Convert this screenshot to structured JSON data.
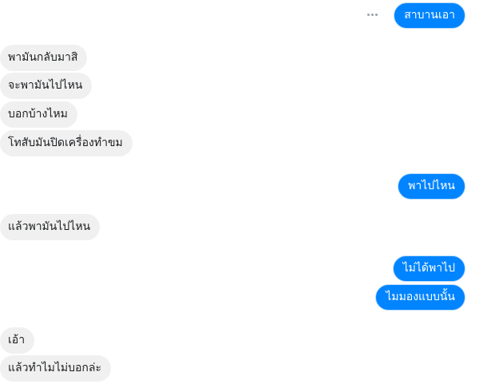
{
  "messages": {
    "m1": {
      "text": "สาบานเอา",
      "direction": "outgoing"
    },
    "m2": {
      "text": "พามันกลับมาสิ",
      "direction": "incoming"
    },
    "m3": {
      "text": "จะพามันไปไหน",
      "direction": "incoming"
    },
    "m4": {
      "text": "บอกบ้างไหม",
      "direction": "incoming"
    },
    "m5": {
      "text": "โทสับมันปิดเครื่องทำขม",
      "direction": "incoming"
    },
    "m6": {
      "text": "พาไปไหน",
      "direction": "outgoing"
    },
    "m7": {
      "text": "แล้วพามันไปไหน",
      "direction": "incoming"
    },
    "m8": {
      "text": "ไม่ได้พาไป",
      "direction": "outgoing"
    },
    "m9": {
      "text": "ไมมองแบบนั้น",
      "direction": "outgoing"
    },
    "m10": {
      "text": "เอ้า",
      "direction": "incoming"
    },
    "m11": {
      "text": "แล้วทำไมไม่บอกล่ะ",
      "direction": "incoming"
    }
  },
  "icons": {
    "more_options": "more-options-icon"
  },
  "colors": {
    "outgoing_bubble": "#0084ff",
    "incoming_bubble": "#f0f0f0",
    "outgoing_text": "#ffffff",
    "incoming_text": "#1c1e21"
  }
}
